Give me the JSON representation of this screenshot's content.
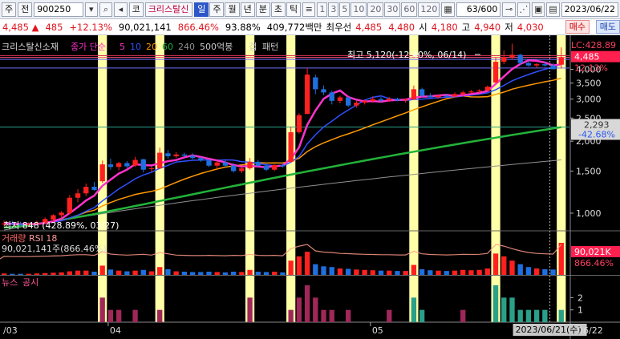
{
  "toolbar": {
    "market": "주",
    "all_btn": "전",
    "code": "900250",
    "type_btn": "코",
    "name": "크리스탈신",
    "periods": [
      "일",
      "주",
      "월",
      "년",
      "분",
      "초",
      "틱"
    ],
    "selected_period": "일",
    "nums": [
      "1",
      "3",
      "5",
      "10",
      "20",
      "30",
      "60",
      "120"
    ],
    "count": "63/600",
    "date": "2023/06/22"
  },
  "pricebar": {
    "price": "4,485",
    "change": "485",
    "change_pct": "+12.13%",
    "volume": "90,021,141",
    "vol_ratio": "866.46%",
    "turnover_pct": "93.88%",
    "amount": "409,772백만",
    "best_label": "최우선",
    "ask": "4,485",
    "bid": "4,480",
    "open_label": "시",
    "open": "4,180",
    "high_label": "고",
    "high": "4,940",
    "low_label": "저",
    "low": "4,030",
    "buy": "매수",
    "sell": "매도"
  },
  "colors": {
    "up": "#ff2020",
    "down": "#1f6fe0",
    "ma5": "#ff33cc",
    "ma10": "#3050ff",
    "ma20": "#ff9900",
    "ma60": "#22b33a",
    "ma240": "#909090",
    "highlight": "#ffffa8",
    "teal": "#2aa089",
    "maroon": "#a0275a"
  },
  "chart_data": [
    {
      "type": "candlestick",
      "title": "크리스탈신소재",
      "legend": [
        {
          "label": "종가 단순",
          "color": "#ff33cc"
        },
        {
          "label": "5",
          "color": "#ff33cc"
        },
        {
          "label": "10",
          "color": "#3050ff"
        },
        {
          "label": "20",
          "color": "#ff9900"
        },
        {
          "label": "60",
          "color": "#22b33a"
        },
        {
          "label": "240",
          "color": "#909090"
        },
        {
          "label": "500억봉",
          "color": "#cccccc"
        },
        {
          "label": "갭",
          "color": "#cccccc"
        },
        {
          "label": "패턴",
          "color": "#cccccc"
        }
      ],
      "y_ticks": [
        1000,
        1500,
        2000,
        2500,
        3000,
        3500,
        4000
      ],
      "ylim": [
        850,
        5300
      ],
      "x_labels": [
        "/03",
        "04",
        "05",
        "06"
      ],
      "annotations": {
        "high_text": "최고 5,120(-12.40%, 06/14)",
        "low_text": "최저 848 (428.89%, 03/27)",
        "lc_text": "LC:428.89",
        "hc_text": "HC:-12.40",
        "cur_price": "4,485",
        "cur_pct": "12.13%",
        "ma_value": "2,293",
        "ma_pct": "-42.68%",
        "cursor_date": "2023/06/21(수)",
        "right_date": "06/22"
      },
      "highlight_bars": [
        12,
        19,
        30,
        35,
        50,
        60,
        68
      ],
      "candles": [
        {
          "o": 900,
          "h": 930,
          "l": 880,
          "c": 905
        },
        {
          "o": 905,
          "h": 930,
          "l": 890,
          "c": 900
        },
        {
          "o": 900,
          "h": 920,
          "l": 880,
          "c": 890
        },
        {
          "o": 890,
          "h": 915,
          "l": 875,
          "c": 900
        },
        {
          "o": 900,
          "h": 930,
          "l": 890,
          "c": 910
        },
        {
          "o": 910,
          "h": 960,
          "l": 900,
          "c": 945
        },
        {
          "o": 940,
          "h": 990,
          "l": 920,
          "c": 980
        },
        {
          "o": 980,
          "h": 1020,
          "l": 950,
          "c": 1005
        },
        {
          "o": 1000,
          "h": 1190,
          "l": 990,
          "c": 1160
        },
        {
          "o": 1160,
          "h": 1260,
          "l": 1110,
          "c": 1210
        },
        {
          "o": 1210,
          "h": 1330,
          "l": 1180,
          "c": 1290
        },
        {
          "o": 1290,
          "h": 1350,
          "l": 1240,
          "c": 1250
        },
        {
          "o": 1360,
          "h": 1660,
          "l": 1340,
          "c": 1600
        },
        {
          "o": 1600,
          "h": 1690,
          "l": 1520,
          "c": 1560
        },
        {
          "o": 1560,
          "h": 1640,
          "l": 1510,
          "c": 1620
        },
        {
          "o": 1620,
          "h": 1650,
          "l": 1540,
          "c": 1570
        },
        {
          "o": 1580,
          "h": 1720,
          "l": 1560,
          "c": 1670
        },
        {
          "o": 1680,
          "h": 1690,
          "l": 1480,
          "c": 1520
        },
        {
          "o": 1530,
          "h": 1570,
          "l": 1490,
          "c": 1540
        },
        {
          "o": 1540,
          "h": 1880,
          "l": 1530,
          "c": 1790
        },
        {
          "o": 1780,
          "h": 1840,
          "l": 1690,
          "c": 1730
        },
        {
          "o": 1730,
          "h": 1800,
          "l": 1700,
          "c": 1760
        },
        {
          "o": 1760,
          "h": 1790,
          "l": 1720,
          "c": 1740
        },
        {
          "o": 1740,
          "h": 1780,
          "l": 1680,
          "c": 1700
        },
        {
          "o": 1700,
          "h": 1720,
          "l": 1640,
          "c": 1660
        },
        {
          "o": 1660,
          "h": 1680,
          "l": 1560,
          "c": 1580
        },
        {
          "o": 1580,
          "h": 1650,
          "l": 1530,
          "c": 1630
        },
        {
          "o": 1630,
          "h": 1660,
          "l": 1560,
          "c": 1580
        },
        {
          "o": 1580,
          "h": 1620,
          "l": 1480,
          "c": 1500
        },
        {
          "o": 1500,
          "h": 1560,
          "l": 1470,
          "c": 1540
        },
        {
          "o": 1540,
          "h": 1700,
          "l": 1520,
          "c": 1640
        },
        {
          "o": 1640,
          "h": 1670,
          "l": 1560,
          "c": 1580
        },
        {
          "o": 1580,
          "h": 1620,
          "l": 1500,
          "c": 1520
        },
        {
          "o": 1520,
          "h": 1600,
          "l": 1500,
          "c": 1590
        },
        {
          "o": 1590,
          "h": 1620,
          "l": 1550,
          "c": 1570
        },
        {
          "o": 1640,
          "h": 2300,
          "l": 1630,
          "c": 2180
        },
        {
          "o": 2180,
          "h": 2620,
          "l": 2150,
          "c": 2570
        },
        {
          "o": 2600,
          "h": 4050,
          "l": 2600,
          "c": 3800
        },
        {
          "o": 3700,
          "h": 3800,
          "l": 3150,
          "c": 3300
        },
        {
          "o": 3300,
          "h": 3420,
          "l": 3120,
          "c": 3200
        },
        {
          "o": 3200,
          "h": 3260,
          "l": 2850,
          "c": 2950
        },
        {
          "o": 2950,
          "h": 3100,
          "l": 2880,
          "c": 3050
        },
        {
          "o": 3050,
          "h": 3080,
          "l": 2780,
          "c": 2820
        },
        {
          "o": 2820,
          "h": 2950,
          "l": 2760,
          "c": 2900
        },
        {
          "o": 2900,
          "h": 2980,
          "l": 2850,
          "c": 2950
        },
        {
          "o": 2950,
          "h": 3080,
          "l": 2900,
          "c": 3000
        },
        {
          "o": 3000,
          "h": 3060,
          "l": 2920,
          "c": 2960
        },
        {
          "o": 2960,
          "h": 3060,
          "l": 2920,
          "c": 3010
        },
        {
          "o": 3010,
          "h": 3040,
          "l": 2940,
          "c": 2960
        },
        {
          "o": 2960,
          "h": 3020,
          "l": 2900,
          "c": 2990
        },
        {
          "o": 2990,
          "h": 3420,
          "l": 2980,
          "c": 3300
        },
        {
          "o": 3300,
          "h": 3350,
          "l": 3050,
          "c": 3100
        },
        {
          "o": 3100,
          "h": 3180,
          "l": 3020,
          "c": 3050
        },
        {
          "o": 3050,
          "h": 3130,
          "l": 3010,
          "c": 3100
        },
        {
          "o": 3100,
          "h": 3150,
          "l": 3050,
          "c": 3080
        },
        {
          "o": 3080,
          "h": 3200,
          "l": 3060,
          "c": 3150
        },
        {
          "o": 3150,
          "h": 3250,
          "l": 3100,
          "c": 3200
        },
        {
          "o": 3200,
          "h": 3280,
          "l": 3150,
          "c": 3230
        },
        {
          "o": 3230,
          "h": 3300,
          "l": 3180,
          "c": 3260
        },
        {
          "o": 3260,
          "h": 3420,
          "l": 3240,
          "c": 3380
        },
        {
          "o": 3520,
          "h": 4500,
          "l": 3500,
          "c": 4300
        },
        {
          "o": 4300,
          "h": 4800,
          "l": 4200,
          "c": 4500
        },
        {
          "o": 4500,
          "h": 5120,
          "l": 4400,
          "c": 4600
        },
        {
          "o": 4600,
          "h": 4650,
          "l": 4150,
          "c": 4250
        },
        {
          "o": 4250,
          "h": 4350,
          "l": 4100,
          "c": 4150
        },
        {
          "o": 4150,
          "h": 4250,
          "l": 4050,
          "c": 4200
        },
        {
          "o": 4200,
          "h": 4300,
          "l": 4100,
          "c": 4150
        },
        {
          "o": 4150,
          "h": 4250,
          "l": 4050,
          "c": 4000
        },
        {
          "o": 4180,
          "h": 4940,
          "l": 4030,
          "c": 4485
        }
      ]
    },
    {
      "type": "bar",
      "title": "거래량",
      "legend": [
        {
          "label": "거래량",
          "color": "#ff6666"
        },
        {
          "label": "RSI 18",
          "color": "#ff9999"
        }
      ],
      "left_label": "90,021,141주(866.46%)",
      "right_value": "90,021K",
      "right_pct": "866.46%",
      "values": [
        4,
        3,
        3,
        3,
        4,
        5,
        6,
        7,
        10,
        12,
        12,
        9,
        26,
        15,
        12,
        10,
        12,
        14,
        10,
        22,
        16,
        10,
        9,
        8,
        8,
        9,
        8,
        7,
        9,
        8,
        14,
        9,
        8,
        9,
        7,
        40,
        52,
        65,
        30,
        24,
        22,
        18,
        17,
        15,
        14,
        13,
        12,
        12,
        11,
        11,
        28,
        16,
        13,
        12,
        11,
        12,
        14,
        13,
        14,
        18,
        60,
        52,
        40,
        30,
        22,
        18,
        16,
        15,
        90
      ]
    },
    {
      "type": "bar",
      "title": "공시",
      "legend": [
        {
          "label": "뉴스",
          "color": "#a0275a"
        },
        {
          "label": "공시",
          "color": "#a0275a"
        }
      ],
      "y_ticks": [
        1,
        2
      ],
      "values": [
        0,
        0,
        0,
        0,
        0,
        0,
        0,
        0,
        0,
        0,
        0,
        0,
        2,
        1,
        1,
        0,
        1,
        0,
        0,
        1,
        0,
        0,
        0,
        0,
        0,
        0,
        0,
        0,
        0,
        0,
        2,
        0,
        0,
        0,
        0,
        1,
        2,
        3,
        2,
        1,
        1,
        0,
        1,
        0,
        0,
        0,
        0,
        1,
        0,
        0,
        2,
        1,
        0,
        0,
        0,
        0,
        1,
        0,
        0,
        0,
        3,
        2,
        2,
        1,
        1,
        1,
        1,
        0,
        1
      ],
      "types": [
        "n",
        "n",
        "n",
        "n",
        "n",
        "n",
        "n",
        "n",
        "n",
        "n",
        "n",
        "n",
        "n",
        "n",
        "n",
        "n",
        "n",
        "n",
        "n",
        "n",
        "n",
        "n",
        "n",
        "n",
        "n",
        "n",
        "n",
        "n",
        "n",
        "n",
        "n",
        "n",
        "n",
        "n",
        "n",
        "n",
        "n",
        "n",
        "n",
        "n",
        "n",
        "n",
        "n",
        "n",
        "n",
        "n",
        "n",
        "n",
        "n",
        "n",
        "t",
        "t",
        "n",
        "n",
        "n",
        "n",
        "n",
        "n",
        "n",
        "n",
        "t",
        "t",
        "t",
        "t",
        "t",
        "t",
        "t",
        "n",
        "t"
      ]
    }
  ]
}
